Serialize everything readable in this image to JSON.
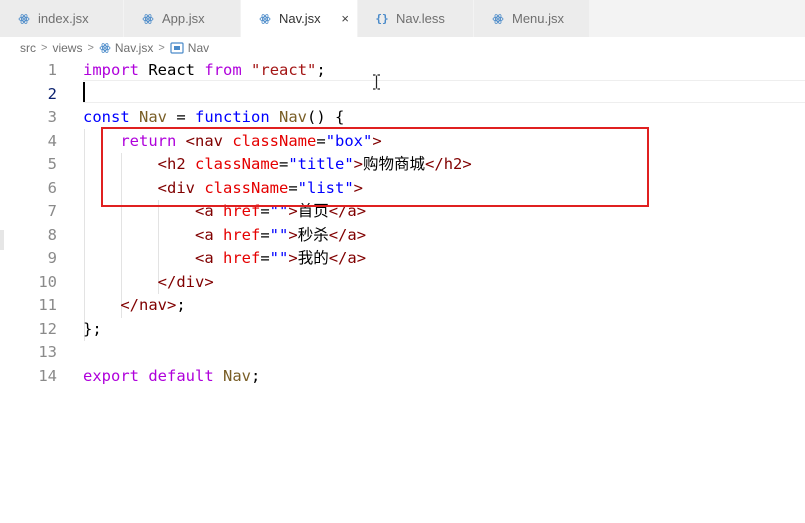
{
  "tabs": [
    {
      "label": "index.jsx",
      "icon": "react-icon",
      "active": false
    },
    {
      "label": "App.jsx",
      "icon": "react-icon",
      "active": false
    },
    {
      "label": "Nav.jsx",
      "icon": "react-icon",
      "active": true
    },
    {
      "label": "Nav.less",
      "icon": "braces-icon",
      "active": false
    },
    {
      "label": "Menu.jsx",
      "icon": "react-icon",
      "active": false
    }
  ],
  "tab_close_glyph": "×",
  "brace_glyph": "{}",
  "breadcrumb": {
    "src": "src",
    "views": "views",
    "file": "Nav.jsx",
    "symbol": "Nav",
    "sep": ">"
  },
  "code": {
    "line_numbers": [
      "1",
      "2",
      "3",
      "4",
      "5",
      "6",
      "7",
      "8",
      "9",
      "10",
      "11",
      "12",
      "13",
      "14"
    ],
    "l1": {
      "import": "import",
      "react_id": "React",
      "from": "from",
      "module": "\"react\"",
      "semi": ";"
    },
    "l3": {
      "const": "const",
      "name": "Nav",
      "eq": " = ",
      "function": "function",
      "fname": "Nav",
      "rest": "() {"
    },
    "l4": {
      "return": "return",
      "open": "<nav",
      "attr": "className",
      "eq": "=",
      "val": "\"box\"",
      "close": ">"
    },
    "l5": {
      "open": "<h2",
      "attr": "className",
      "eq": "=",
      "val": "\"title\"",
      "gt": ">",
      "text": "购物商城",
      "end": "</h2>"
    },
    "l6": {
      "open": "<div",
      "attr": "className",
      "eq": "=",
      "val": "\"list\"",
      "close": ">"
    },
    "l7": {
      "open": "<a",
      "attr": "href",
      "eq": "=",
      "val": "\"\"",
      "gt": ">",
      "text": "首页",
      "end": "</a>"
    },
    "l8": {
      "open": "<a",
      "attr": "href",
      "eq": "=",
      "val": "\"\"",
      "gt": ">",
      "text": "秒杀",
      "end": "</a>"
    },
    "l9": {
      "open": "<a",
      "attr": "href",
      "eq": "=",
      "val": "\"\"",
      "gt": ">",
      "text": "我的",
      "end": "</a>"
    },
    "l10": {
      "end": "</div>"
    },
    "l11": {
      "end": "</nav>",
      "semi": ";"
    },
    "l12": {
      "text": "};"
    },
    "l14": {
      "export": "export",
      "default": "default",
      "name": "Nav",
      "semi": ";"
    }
  },
  "colors": {
    "highlight_box": "#e02020",
    "keyword": "#af00db",
    "tag": "#800000",
    "attribute": "#e50000",
    "string": "#0000ff"
  }
}
